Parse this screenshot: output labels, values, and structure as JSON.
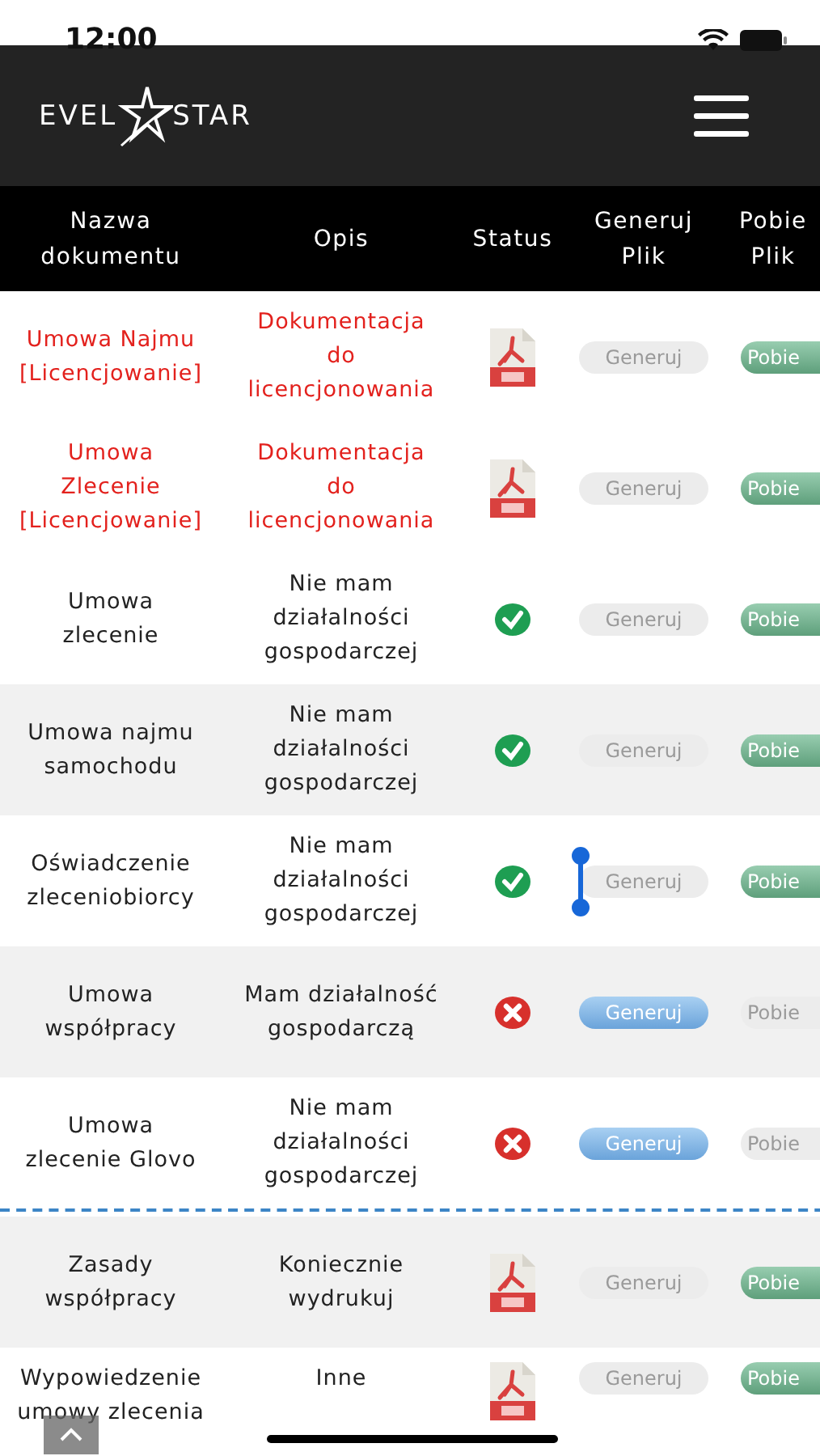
{
  "status_bar": {
    "time": "12:00"
  },
  "header": {
    "logo_left": "EVEL",
    "logo_right": "STAR"
  },
  "table": {
    "columns": [
      "Nazwa dokumentu",
      "Opis",
      "Status",
      "Generuj Plik",
      "Pobie Plik"
    ],
    "sections": [
      {
        "rows": [
          {
            "name": "Umowa Najmu [Licencjowanie]",
            "description": "Dokumentacja do licencjonowania",
            "highlighted": true,
            "kind": "pdf",
            "generate": {
              "label": "Generuj",
              "disabled": true
            },
            "download": {
              "label": "Pobie",
              "disabled": false
            },
            "text_cursor": false
          },
          {
            "name": "Umowa Zlecenie [Licencjowanie]",
            "description": "Dokumentacja do licencjonowania",
            "highlighted": true,
            "kind": "pdf",
            "generate": {
              "label": "Generuj",
              "disabled": true
            },
            "download": {
              "label": "Pobie",
              "disabled": false
            },
            "text_cursor": false
          },
          {
            "name": "Umowa zlecenie",
            "description": "Nie mam działalności gospodarczej",
            "highlighted": false,
            "kind": "ok",
            "generate": {
              "label": "Generuj",
              "disabled": true
            },
            "download": {
              "label": "Pobie",
              "disabled": false
            },
            "text_cursor": false
          },
          {
            "name": "Umowa najmu samochodu",
            "description": "Nie mam działalności gospodarczej",
            "highlighted": false,
            "kind": "ok",
            "generate": {
              "label": "Generuj",
              "disabled": true
            },
            "download": {
              "label": "Pobie",
              "disabled": false
            },
            "text_cursor": false
          },
          {
            "name": "Oświadczenie zleceniobiorcy",
            "description": "Nie mam działalności gospodarczej",
            "highlighted": false,
            "kind": "ok",
            "generate": {
              "label": "Generuj",
              "disabled": true
            },
            "download": {
              "label": "Pobie",
              "disabled": false
            },
            "text_cursor": true
          },
          {
            "name": "Umowa współpracy",
            "description": "Mam działalność gospodarczą",
            "highlighted": false,
            "kind": "error",
            "generate": {
              "label": "Generuj",
              "disabled": false
            },
            "download": {
              "label": "Pobie",
              "disabled": true
            },
            "text_cursor": false
          },
          {
            "name": "Umowa zlecenie Glovo",
            "description": "Nie mam działalności gospodarczej",
            "highlighted": false,
            "kind": "error",
            "generate": {
              "label": "Generuj",
              "disabled": false
            },
            "download": {
              "label": "Pobie",
              "disabled": true
            },
            "text_cursor": false
          }
        ]
      },
      {
        "rows": [
          {
            "name": "Zasady współpracy",
            "description": "Koniecznie wydrukuj",
            "highlighted": false,
            "kind": "pdf",
            "generate": {
              "label": "Generuj",
              "disabled": true
            },
            "download": {
              "label": "Pobie",
              "disabled": false
            },
            "text_cursor": false
          },
          {
            "name": "Wypowiedzenie umowy zlecenia",
            "description": "Inne",
            "highlighted": false,
            "kind": "pdf",
            "generate": {
              "label": "Generuj",
              "disabled": true
            },
            "download": {
              "label": "Pobie",
              "disabled": false
            },
            "text_cursor": false
          }
        ]
      }
    ]
  }
}
